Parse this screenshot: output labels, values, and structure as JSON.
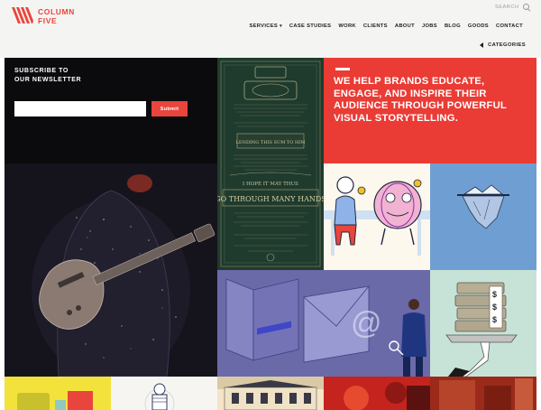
{
  "brand": {
    "name_line1": "COLUMN",
    "name_line2": "FIVE",
    "accent": "#e8453c"
  },
  "header": {
    "search_label": "SEARCH",
    "nav": [
      {
        "label": "SERVICES",
        "has_caret": true
      },
      {
        "label": "CASE STUDIES"
      },
      {
        "label": "WORK"
      },
      {
        "label": "CLIENTS"
      },
      {
        "label": "ABOUT"
      },
      {
        "label": "JOBS"
      },
      {
        "label": "BLOG"
      },
      {
        "label": "GOODS"
      },
      {
        "label": "CONTACT"
      }
    ],
    "categories_label": "CATEGORIES"
  },
  "newsletter": {
    "title_line1": "SUBSCRIBE TO",
    "title_line2": "OUR NEWSLETTER",
    "input_value": "",
    "submit_label": "Submit"
  },
  "mission": {
    "text": "WE HELP BRANDS EDUCATE, ENGAGE, AND INSPIRE THEIR AUDIENCE THROUGH POWERFUL VISUAL STORYTELLING."
  },
  "certificate": {
    "line1": "LENDING THIS SUM TO HIM",
    "line2": "I HOPE IT MAY THUS",
    "line3": "GO THROUGH MANY HANDS"
  },
  "email_tile": {
    "envelope_letter": "@"
  },
  "money_tile": {
    "bill_symbol": "$"
  },
  "icons": {
    "search": "search-icon",
    "caret": "caret-down-icon",
    "categories": "arrow-left-icon",
    "logo": "column-five-logo-icon"
  }
}
